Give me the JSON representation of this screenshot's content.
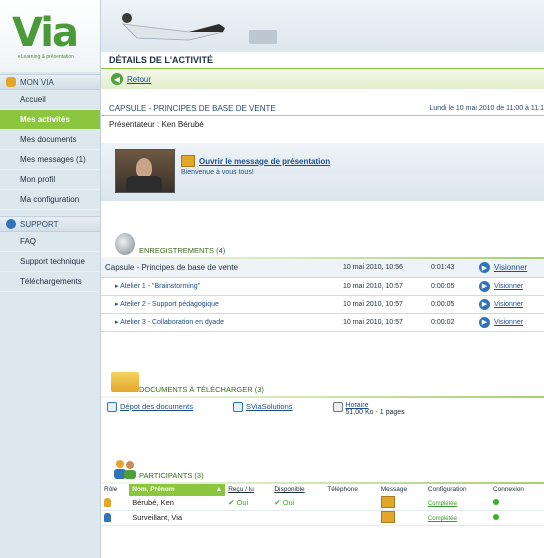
{
  "logo": {
    "text": "Via",
    "tagline": "eLearning & présentation"
  },
  "sidebar": {
    "section1": "MON VIA",
    "items1": [
      "Accueil",
      "Mes activités",
      "Mes documents",
      "Mes messages (1)",
      "Mon profil",
      "Ma configuration"
    ],
    "section2": "SUPPORT",
    "items2": [
      "FAQ",
      "Support technique",
      "Téléchargements"
    ]
  },
  "main": {
    "title": "DÉTAILS DE L'ACTIVITÉ",
    "back": "Retour",
    "capsule_title": "CAPSULE - PRINCIPES DE BASE DE VENTE",
    "capsule_date": "Lundi le 10 mai 2010 de 11:00 à 11:1",
    "presenter": "Présentateur : Ken Bérubé",
    "video_link": "Ouvrir le message de présentation",
    "video_sub": "Bienvenue à vous tous!"
  },
  "recordings": {
    "title": "ENREGISTREMENTS (4)",
    "rows": [
      {
        "name": "Capsule - Principes de base de vente",
        "date": "10 mai 2010, 10:56",
        "dur": "0:01:43",
        "action": "Visionner"
      },
      {
        "name": "Atelier 1 - \"Brainstorming\"",
        "date": "10 mai 2010, 10:57",
        "dur": "0:00:05",
        "action": "Visionner"
      },
      {
        "name": "Atelier 2 - Support pédagogique",
        "date": "10 mai 2010, 10:57",
        "dur": "0:00:05",
        "action": "Visionner"
      },
      {
        "name": "Atelier 3 - Collaboration en dyade",
        "date": "10 mai 2010, 10:57",
        "dur": "0:00:02",
        "action": "Visionner"
      }
    ]
  },
  "documents": {
    "title": "DOCUMENTS À TÉLÉCHARGER (3)",
    "items": [
      "Dépot des documents",
      "SViaSolutions"
    ],
    "horaire_label": "Horaire",
    "horaire_meta": "51,00 Ko - 1 pages"
  },
  "participants": {
    "title": "PARTICIPANTS (3)",
    "headers": [
      "Rôle",
      "Nom, Prénom",
      "Reçu / lu",
      "Disponible",
      "Téléphone",
      "Message",
      "Configuration",
      "Connexion"
    ],
    "rows": [
      {
        "name": "Bérubé, Ken",
        "recu": "Oui",
        "dispo": "Oui",
        "config": "Complétée"
      },
      {
        "name": "Surveillant, Via",
        "recu": "",
        "dispo": "",
        "config": "Complétée"
      }
    ]
  }
}
